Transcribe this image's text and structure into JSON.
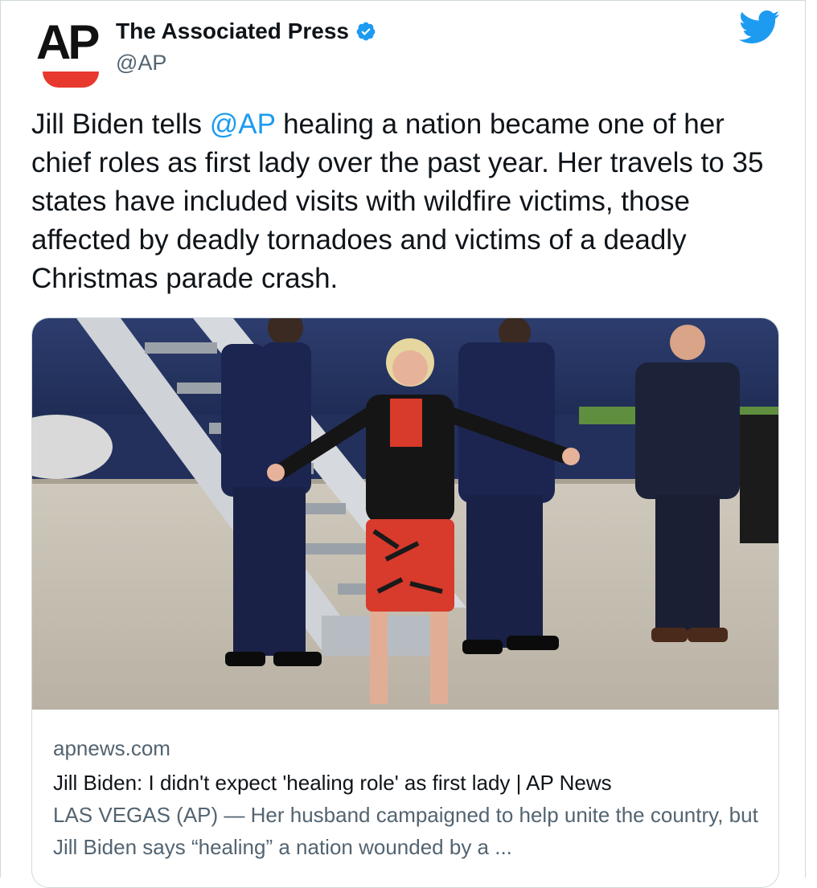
{
  "author": {
    "display_name": "The Associated Press",
    "handle": "@AP",
    "avatar_text": "AP",
    "verified": true
  },
  "tweet": {
    "text_before": "Jill Biden tells ",
    "mention": "@AP",
    "text_after": " healing a nation became one of her chief roles as first lady over the past year. Her travels to 35 states have included visits with wildfire victims, those affected by deadly tornadoes and victims of a deadly Christmas parade crash."
  },
  "card": {
    "domain": "apnews.com",
    "title": "Jill Biden: I didn't expect 'healing role' as first lady | AP News",
    "description": "LAS VEGAS (AP) — Her husband campaigned to help unite the country, but Jill Biden says “healing” a nation wounded by a ..."
  },
  "icons": {
    "verified": "verified-badge-icon",
    "platform": "twitter-bird-icon"
  },
  "colors": {
    "accent": "#1d9bf0",
    "ap_red": "#e8392e",
    "text": "#0f1419",
    "muted": "#536471"
  }
}
